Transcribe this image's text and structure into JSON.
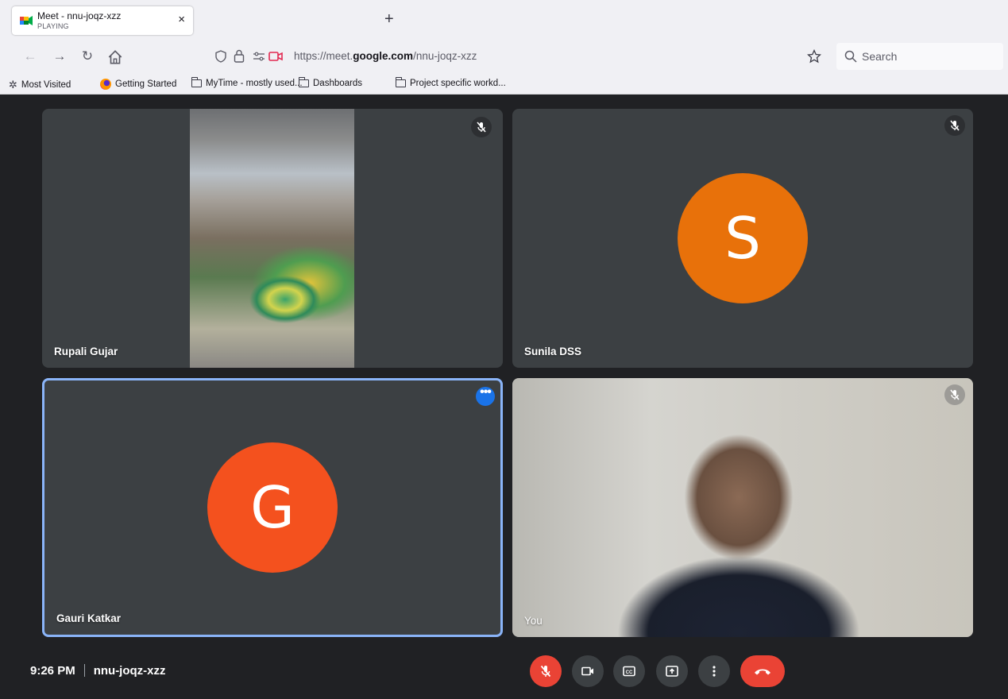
{
  "browser": {
    "tab": {
      "title": "Meet - nnu-joqz-xzz",
      "subtitle": "PLAYING",
      "close": "×"
    },
    "new_tab": "+",
    "url": {
      "prefix": "https://meet.",
      "domain": "google.com",
      "path": "/nnu-joqz-xzz"
    },
    "search_label": "Search",
    "bookmarks": [
      {
        "label": "Most Visited",
        "icon": "gear-icon"
      },
      {
        "label": "Getting Started",
        "icon": "firefox-icon"
      },
      {
        "label": "MyTime - mostly used...",
        "icon": "folder-icon"
      },
      {
        "label": "Dashboards",
        "icon": "folder-icon"
      },
      {
        "label": "Project specific workd...",
        "icon": "folder-icon"
      }
    ]
  },
  "meet": {
    "tiles": [
      {
        "name": "Rupali Gujar",
        "type": "video",
        "muted": true
      },
      {
        "name": "Sunila DSS",
        "type": "avatar",
        "initial": "S",
        "avatar_color": "#e8710a",
        "muted": true
      },
      {
        "name": "Gauri Katkar",
        "type": "avatar",
        "initial": "G",
        "avatar_color": "#f4511e",
        "active_speaker": true
      },
      {
        "name": "You",
        "type": "video",
        "muted": true
      }
    ],
    "time": "9:26 PM",
    "meeting_code": "nnu-joqz-xzz",
    "controls": [
      "microphone-off",
      "camera",
      "captions",
      "present",
      "more-options",
      "leave-call"
    ]
  },
  "colors": {
    "background": "#202124",
    "tile": "#3c4043",
    "accent": "#1a73e8",
    "danger": "#ea4335"
  }
}
